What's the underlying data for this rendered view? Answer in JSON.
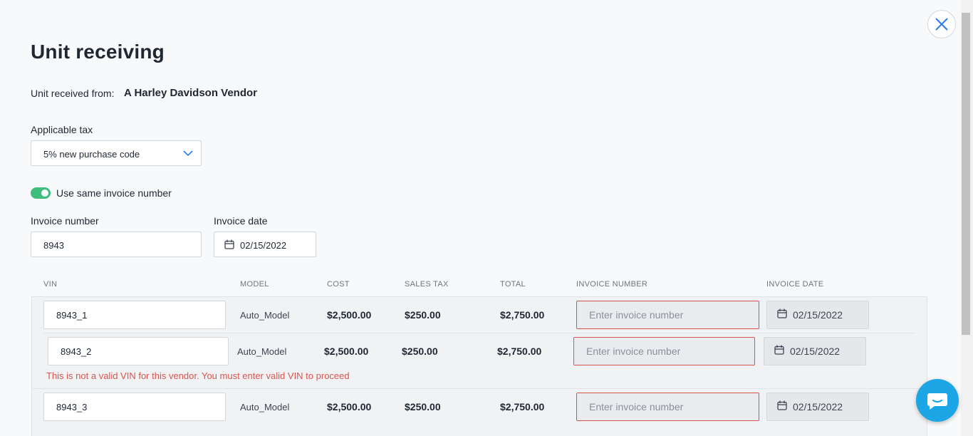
{
  "header": {
    "title": "Unit receiving"
  },
  "vendor": {
    "label": "Unit received from:",
    "value": "A Harley Davidson Vendor"
  },
  "tax": {
    "label": "Applicable tax",
    "selected": "5% new purchase code"
  },
  "toggle": {
    "label": "Use same invoice number",
    "on": true
  },
  "invoice": {
    "number_label": "Invoice number",
    "number_value": "8943",
    "date_label": "Invoice date",
    "date_value": "02/15/2022"
  },
  "table": {
    "columns": [
      "VIN",
      "MODEL",
      "COST",
      "SALES TAX",
      "TOTAL",
      "INVOICE NUMBER",
      "INVOICE DATE"
    ],
    "rows": [
      {
        "vin": "8943_1",
        "model": "Auto_Model",
        "cost": "$2,500.00",
        "sales_tax": "$250.00",
        "total": "$2,750.00",
        "invoice_placeholder": "Enter invoice number",
        "invoice_date": "02/15/2022"
      },
      {
        "vin": "8943_2",
        "model": "Auto_Model",
        "cost": "$2,500.00",
        "sales_tax": "$250.00",
        "total": "$2,750.00",
        "invoice_placeholder": "Enter invoice number",
        "invoice_date": "02/15/2022",
        "error": "This is not a valid VIN for this vendor. You must enter valid VIN to proceed"
      },
      {
        "vin": "8943_3",
        "model": "Auto_Model",
        "cost": "$2,500.00",
        "sales_tax": "$250.00",
        "total": "$2,750.00",
        "invoice_placeholder": "Enter invoice number",
        "invoice_date": "02/15/2022"
      }
    ]
  },
  "icons": {
    "close": "close-icon",
    "chevron": "chevron-down-icon",
    "calendar": "calendar-icon",
    "chat": "chat-icon"
  },
  "colors": {
    "accent": "#1ca6e6",
    "toggle_on": "#3ebd7d",
    "error": "#d9544f",
    "chevron": "#2b7de9"
  }
}
